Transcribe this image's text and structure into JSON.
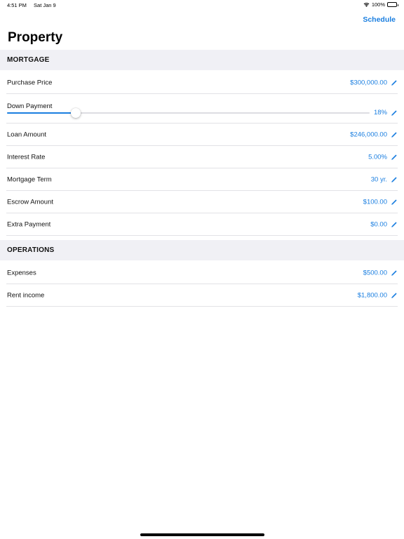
{
  "status_bar": {
    "time": "4:51 PM",
    "date": "Sat Jan 9",
    "battery": "100%"
  },
  "nav": {
    "action_label": "Schedule",
    "title": "Property"
  },
  "colors": {
    "accent": "#1a7ee0",
    "section_bg": "#f0f0f5"
  },
  "sections": {
    "mortgage": {
      "header": "MORTGAGE",
      "purchase_price": {
        "label": "Purchase Price",
        "value": "$300,000.00"
      },
      "down_payment": {
        "label": "Down Payment",
        "value": "18%",
        "slider_fraction": 0.19
      },
      "loan_amount": {
        "label": "Loan Amount",
        "value": "$246,000.00"
      },
      "interest_rate": {
        "label": "Interest Rate",
        "value": "5.00%"
      },
      "mortgage_term": {
        "label": "Mortgage Term",
        "value": "30 yr."
      },
      "escrow_amount": {
        "label": "Escrow Amount",
        "value": "$100.00"
      },
      "extra_payment": {
        "label": "Extra Payment",
        "value": "$0.00"
      }
    },
    "operations": {
      "header": "OPERATIONS",
      "expenses": {
        "label": "Expenses",
        "value": "$500.00"
      },
      "rent_income": {
        "label": "Rent income",
        "value": "$1,800.00"
      }
    }
  },
  "icons": {
    "edit": "pencil-icon",
    "wifi": "wifi-icon",
    "battery": "battery-icon"
  }
}
